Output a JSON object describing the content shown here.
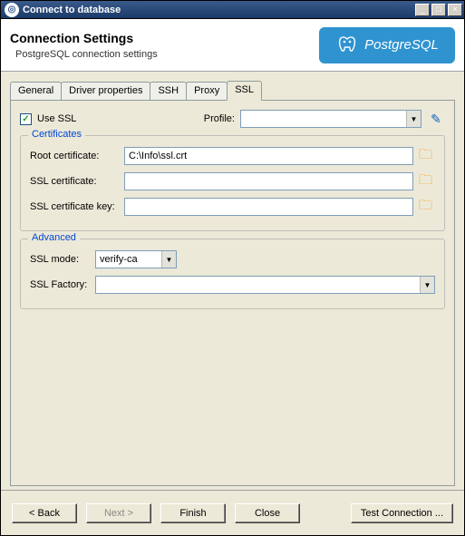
{
  "window": {
    "title": "Connect to database"
  },
  "banner": {
    "title": "Connection Settings",
    "subtitle": "PostgreSQL connection settings",
    "logo_text": "PostgreSQL"
  },
  "tabs": {
    "items": [
      "General",
      "Driver properties",
      "SSH",
      "Proxy",
      "SSL"
    ],
    "active": "SSL"
  },
  "ssl_panel": {
    "use_ssl_label": "Use SSL",
    "use_ssl_checked": true,
    "profile_label": "Profile:",
    "profile_value": ""
  },
  "certs": {
    "group_label": "Certificates",
    "root_label": "Root certificate:",
    "root_value": "C:\\Info\\ssl.crt",
    "cert_label": "SSL certificate:",
    "cert_value": "",
    "key_label": "SSL certificate key:",
    "key_value": ""
  },
  "advanced": {
    "group_label": "Advanced",
    "mode_label": "SSL mode:",
    "mode_value": "verify-ca",
    "factory_label": "SSL Factory:",
    "factory_value": ""
  },
  "buttons": {
    "back": "< Back",
    "next": "Next >",
    "finish": "Finish",
    "close": "Close",
    "test": "Test Connection ..."
  }
}
